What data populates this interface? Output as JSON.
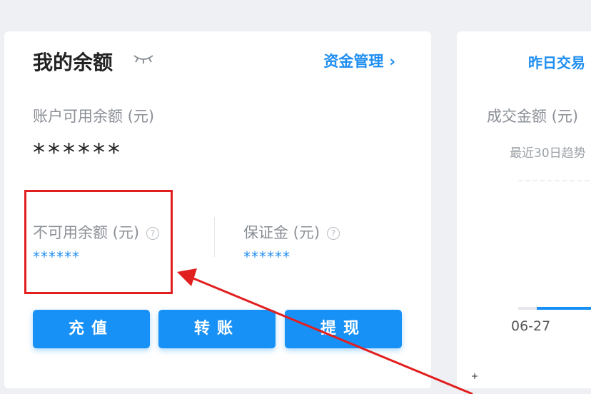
{
  "balance_card": {
    "title": "我的余额",
    "fund_management": "资金管理",
    "fund_management_chevron": "›",
    "available_label": "账户可用余额 (元)",
    "available_value": "******",
    "unavailable_label": "不可用余额 (元)",
    "unavailable_value": "******",
    "deposit_label": "保证金 (元)",
    "deposit_value": "******",
    "help_glyph": "?",
    "buttons": {
      "recharge": "充值",
      "transfer": "转账",
      "withdraw": "提现"
    }
  },
  "yesterday_card": {
    "title": "昨日交易",
    "amount_label": "成交金额 (元)",
    "trend_label": "最近30日趋势",
    "first_tick": "06-27"
  },
  "annotation": {
    "highlight_color": "#e21f1f",
    "arrow_color": "#e21f1f"
  },
  "colors": {
    "accent": "#1891f6",
    "link": "#1f8ef1"
  },
  "icons": [
    "eye-closed-icon",
    "chevron-right-icon",
    "help-circle-icon"
  ]
}
